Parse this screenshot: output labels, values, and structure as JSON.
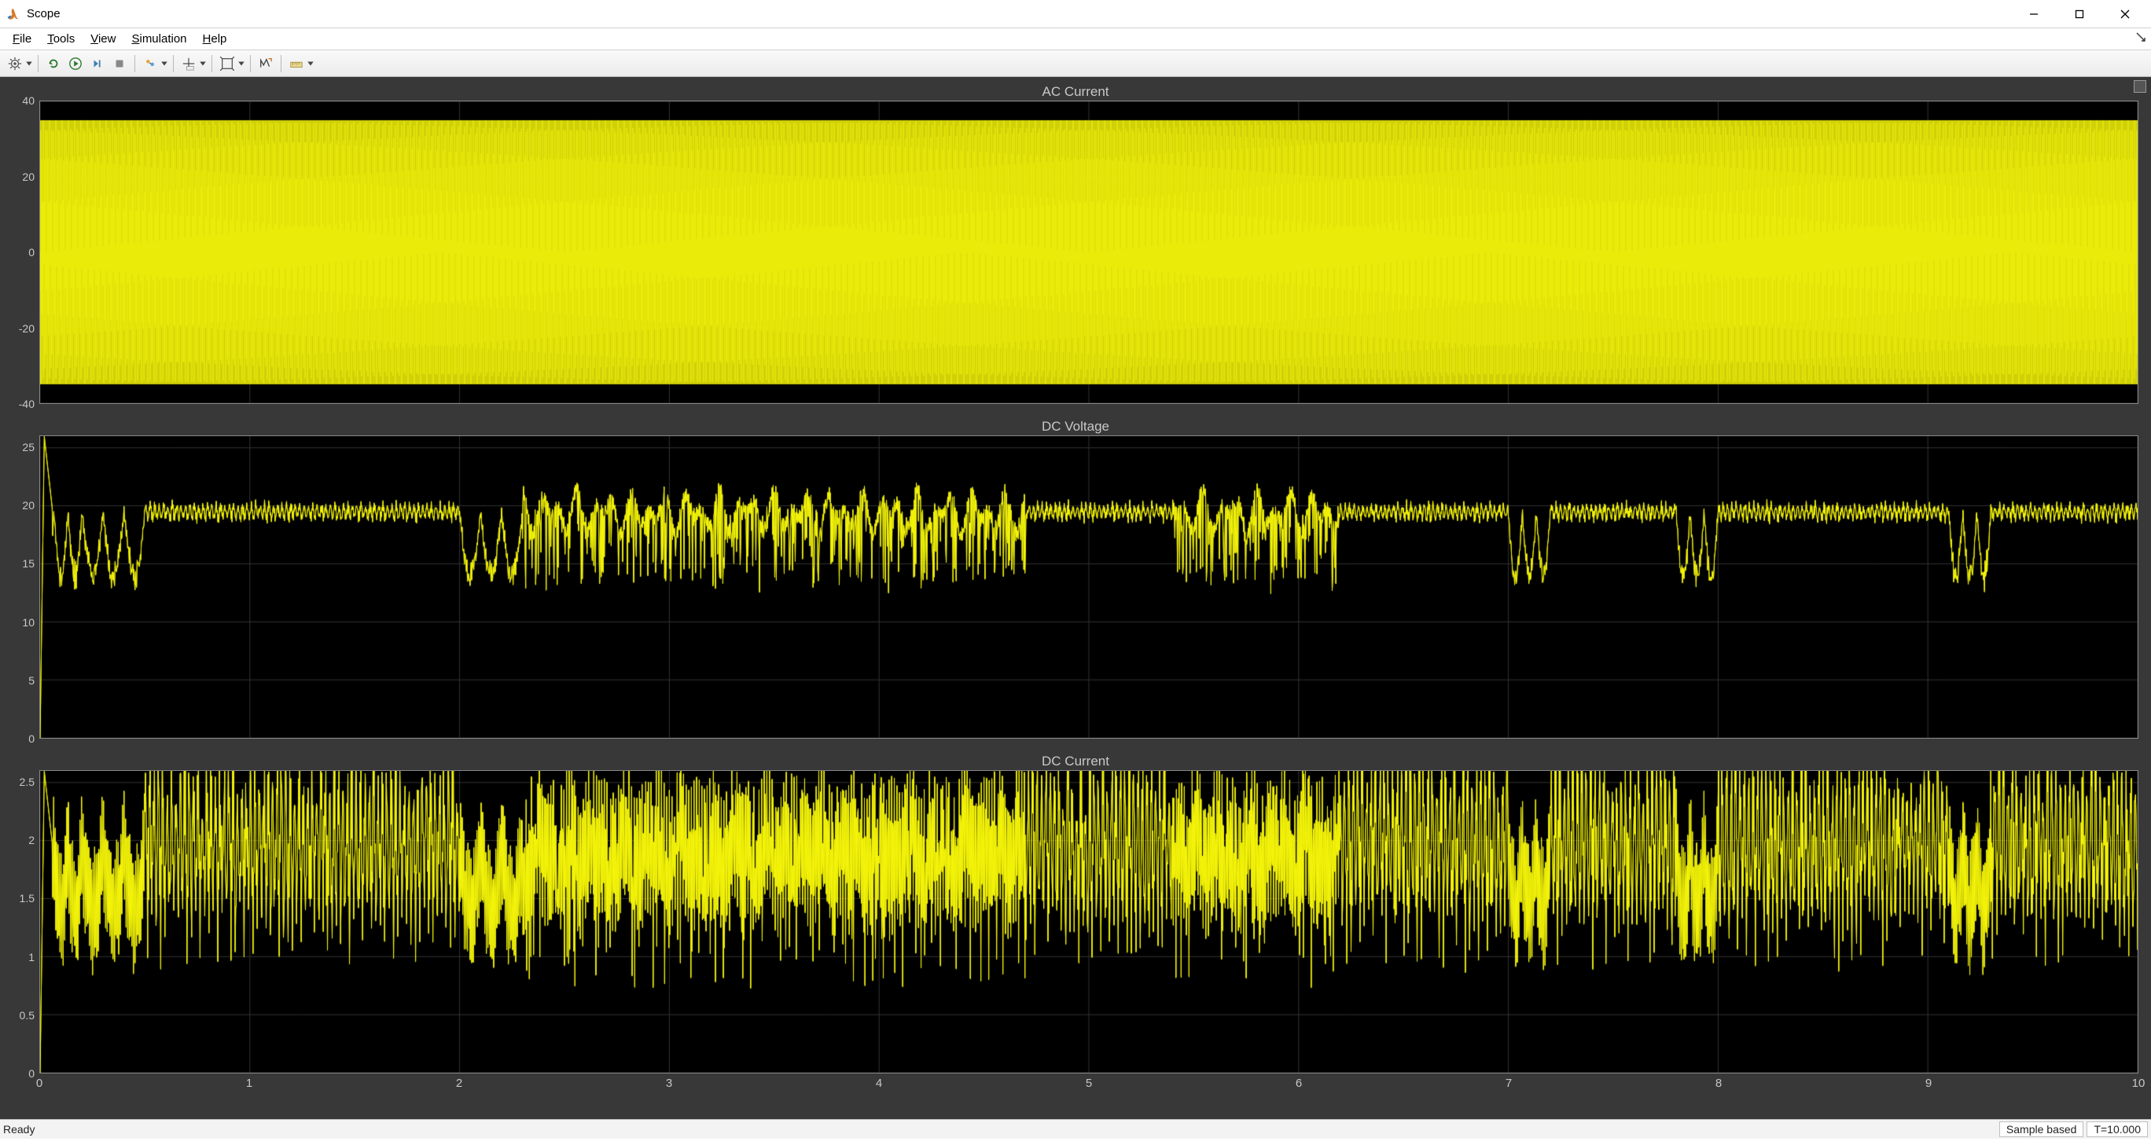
{
  "window": {
    "title": "Scope"
  },
  "menu": {
    "items": [
      "File",
      "Tools",
      "View",
      "Simulation",
      "Help"
    ]
  },
  "toolbar": {
    "icons": [
      "settings",
      "sep",
      "restart",
      "run",
      "step",
      "stop",
      "sep",
      "highlight",
      "sep",
      "cursor",
      "sep",
      "zoom",
      "sep",
      "autoscale",
      "sep",
      "measure"
    ]
  },
  "chart_data": [
    {
      "type": "line",
      "title": "AC Current",
      "xlim": [
        0,
        10
      ],
      "ylim": [
        -40,
        40
      ],
      "yticks": [
        -40,
        -20,
        0,
        20,
        40
      ],
      "waveform": {
        "kind": "sine_dense",
        "amplitude": 35,
        "offset": 0,
        "freq_hz": 50
      }
    },
    {
      "type": "line",
      "title": "DC Voltage",
      "xlim": [
        0,
        10
      ],
      "ylim": [
        0,
        26
      ],
      "yticks": [
        0,
        5,
        10,
        15,
        20,
        25
      ],
      "waveform": {
        "kind": "dc_ripple",
        "base": 19.5,
        "initial": 26,
        "ripple_low": 13,
        "ripple_high": 22
      }
    },
    {
      "type": "line",
      "title": "DC Current",
      "xlim": [
        0,
        10
      ],
      "ylim": [
        0,
        2.6
      ],
      "yticks": [
        0,
        0.5,
        1,
        1.5,
        2,
        2.5
      ],
      "waveform": {
        "kind": "dc_ripple",
        "base": 1.95,
        "initial": 2.6,
        "ripple_low": 1.3,
        "ripple_high": 2.2
      }
    }
  ],
  "xaxis": {
    "ticks": [
      0,
      1,
      2,
      3,
      4,
      5,
      6,
      7,
      8,
      9,
      10
    ]
  },
  "status": {
    "ready": "Ready",
    "mode": "Sample based",
    "time": "T=10.000"
  }
}
